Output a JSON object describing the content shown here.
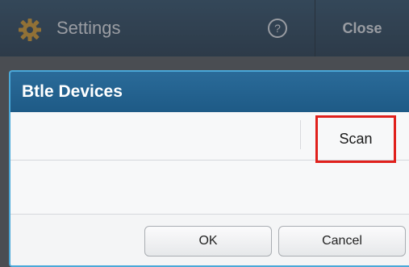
{
  "topbar": {
    "title": "Settings",
    "close_label": "Close",
    "gear_icon": "gear-icon",
    "help_icon": "help-icon"
  },
  "dialog": {
    "title": "Btle Devices",
    "scan_label": "Scan",
    "ok_label": "OK",
    "cancel_label": "Cancel",
    "highlight_color": "#e0201c",
    "header_color": "#1e5a86"
  }
}
